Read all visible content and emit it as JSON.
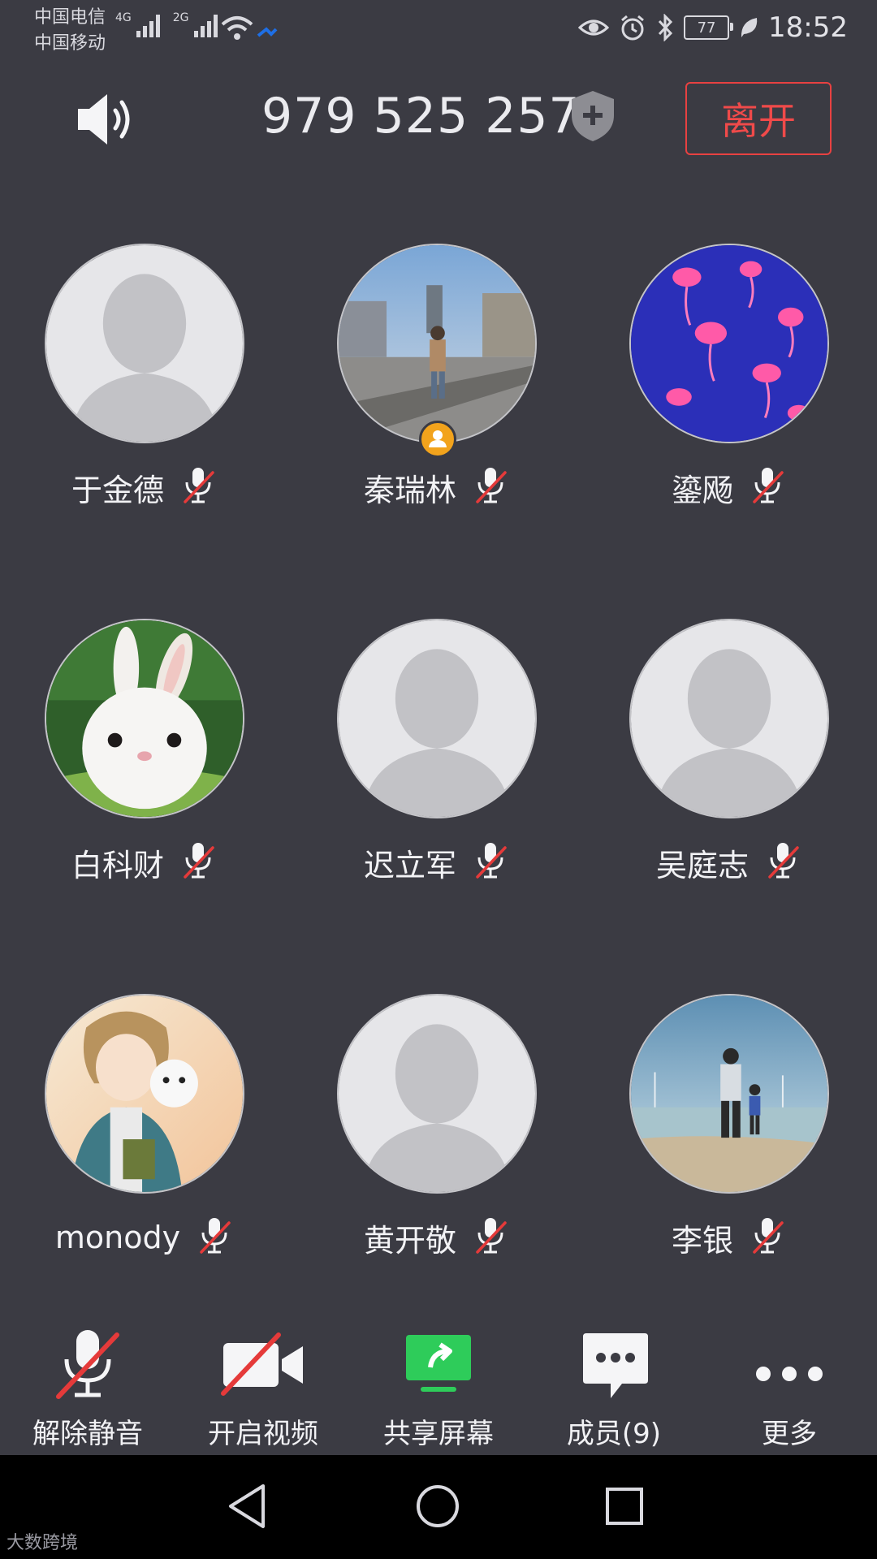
{
  "status_bar": {
    "carrier_1": "中国电信",
    "carrier_2": "中国移动",
    "network_1": "4G",
    "network_2": "2G",
    "battery": "77",
    "time": "18:52"
  },
  "header": {
    "meeting_id": "979 525 257",
    "leave_label": "离开"
  },
  "participants": [
    {
      "name": "于金德",
      "avatar": "default",
      "muted": true
    },
    {
      "name": "秦瑞林",
      "avatar": "street-photo",
      "muted": true,
      "host": true
    },
    {
      "name": "鎏飏",
      "avatar": "jellyfish-photo",
      "muted": true
    },
    {
      "name": "白科财",
      "avatar": "rabbit-photo",
      "muted": true
    },
    {
      "name": "迟立军",
      "avatar": "default",
      "muted": true
    },
    {
      "name": "吴庭志",
      "avatar": "default",
      "muted": true
    },
    {
      "name": "monody",
      "avatar": "anime-photo",
      "muted": true
    },
    {
      "name": "黄开敬",
      "avatar": "default",
      "muted": true
    },
    {
      "name": "李银",
      "avatar": "beach-photo",
      "muted": true
    }
  ],
  "toolbar": {
    "unmute": "解除静音",
    "start_video": "开启视频",
    "share_screen": "共享屏幕",
    "members": "成员(9)",
    "more": "更多"
  },
  "watermark": "大数跨境",
  "colors": {
    "background": "#3b3b43",
    "leave_red": "#e84141",
    "mute_red": "#e53a3a",
    "share_green": "#2ecc5a",
    "host_badge": "#f2a31c"
  }
}
